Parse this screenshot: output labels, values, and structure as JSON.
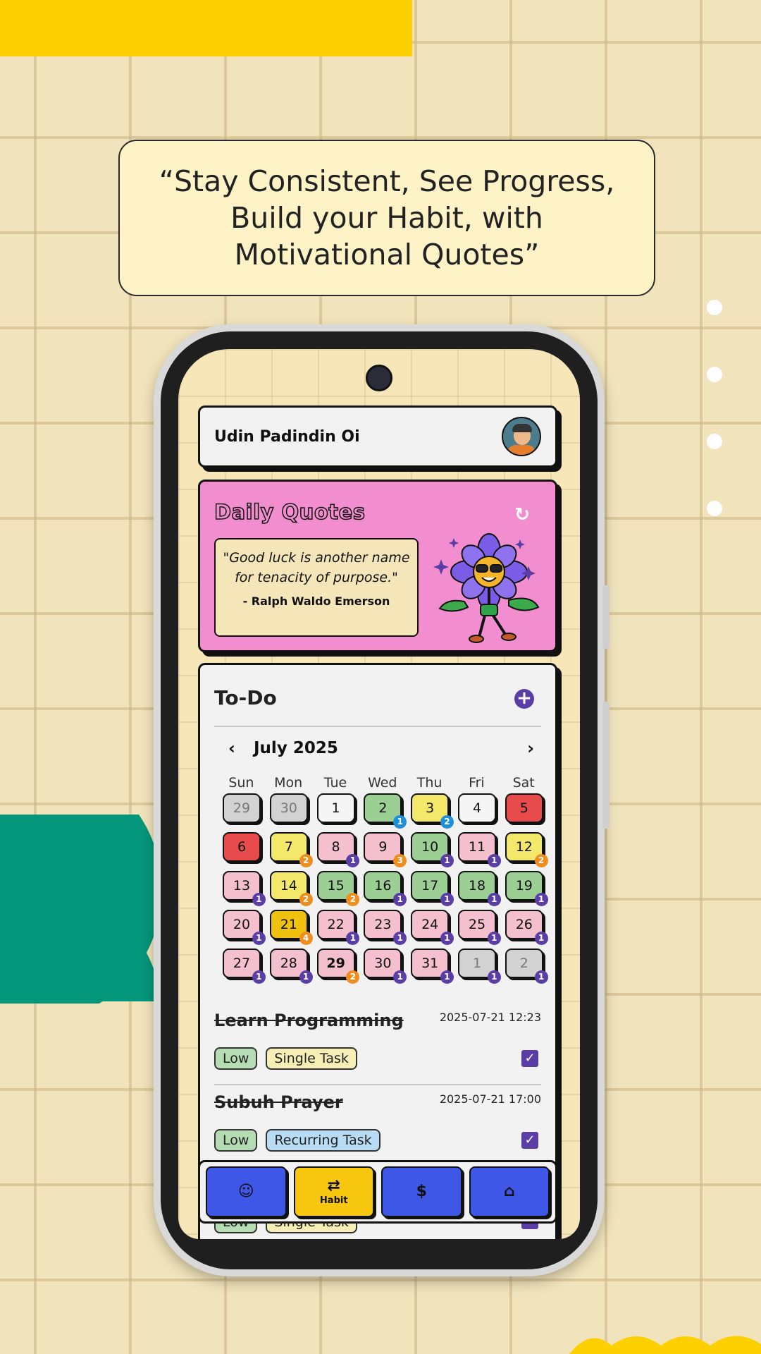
{
  "banner": {
    "quote": "“Stay Consistent, See Progress, Build your Habit, with Motivational Quotes”"
  },
  "profile": {
    "name": "Udin Padindin Oi"
  },
  "daily_quotes": {
    "title": "Daily Quotes",
    "quote": "\"Good luck is another name for tenacity of purpose.\"",
    "author": "- Ralph Waldo Emerson"
  },
  "todo": {
    "title": "To-Do",
    "month": "July 2025",
    "weekdays": [
      "Sun",
      "Mon",
      "Tue",
      "Wed",
      "Thu",
      "Fri",
      "Sat"
    ],
    "days": [
      {
        "d": "29",
        "c": "#d2d2d2",
        "muted": true
      },
      {
        "d": "30",
        "c": "#d2d2d2",
        "muted": true
      },
      {
        "d": "1",
        "c": "#f5f5f5"
      },
      {
        "d": "2",
        "c": "#9ccf94",
        "b": "1",
        "bc": "#1f8fd8"
      },
      {
        "d": "3",
        "c": "#f3e86a",
        "b": "2",
        "bc": "#1f8fd8"
      },
      {
        "d": "4",
        "c": "#f5f5f5"
      },
      {
        "d": "5",
        "c": "#e84b4b"
      },
      {
        "d": "6",
        "c": "#e84b4b"
      },
      {
        "d": "7",
        "c": "#f3e86a",
        "b": "2",
        "bc": "#ef8d1f"
      },
      {
        "d": "8",
        "c": "#f4c0cd",
        "b": "1",
        "bc": "#5a3ea5"
      },
      {
        "d": "9",
        "c": "#f4c0cd",
        "b": "3",
        "bc": "#ef8d1f"
      },
      {
        "d": "10",
        "c": "#9ccf94",
        "b": "1",
        "bc": "#5a3ea5"
      },
      {
        "d": "11",
        "c": "#f4c0cd",
        "b": "1",
        "bc": "#5a3ea5"
      },
      {
        "d": "12",
        "c": "#f3e86a",
        "b": "2",
        "bc": "#ef8d1f"
      },
      {
        "d": "13",
        "c": "#f4c0cd",
        "b": "1",
        "bc": "#5a3ea5"
      },
      {
        "d": "14",
        "c": "#f3e86a",
        "b": "2",
        "bc": "#ef8d1f"
      },
      {
        "d": "15",
        "c": "#9ccf94",
        "b": "2",
        "bc": "#ef8d1f"
      },
      {
        "d": "16",
        "c": "#9ccf94",
        "b": "1",
        "bc": "#5a3ea5"
      },
      {
        "d": "17",
        "c": "#9ccf94",
        "b": "1",
        "bc": "#5a3ea5"
      },
      {
        "d": "18",
        "c": "#9ccf94",
        "b": "1",
        "bc": "#5a3ea5"
      },
      {
        "d": "19",
        "c": "#9ccf94",
        "b": "1",
        "bc": "#5a3ea5"
      },
      {
        "d": "20",
        "c": "#f4c0cd",
        "b": "1",
        "bc": "#5a3ea5"
      },
      {
        "d": "21",
        "c": "#f0c10f",
        "b": "4",
        "bc": "#ef8d1f"
      },
      {
        "d": "22",
        "c": "#f4c0cd",
        "b": "1",
        "bc": "#5a3ea5"
      },
      {
        "d": "23",
        "c": "#f4c0cd",
        "b": "1",
        "bc": "#5a3ea5"
      },
      {
        "d": "24",
        "c": "#f4c0cd",
        "b": "1",
        "bc": "#5a3ea5"
      },
      {
        "d": "25",
        "c": "#f4c0cd",
        "b": "1",
        "bc": "#5a3ea5"
      },
      {
        "d": "26",
        "c": "#f4c0cd",
        "b": "1",
        "bc": "#5a3ea5"
      },
      {
        "d": "27",
        "c": "#f4c0cd",
        "b": "1",
        "bc": "#5a3ea5"
      },
      {
        "d": "28",
        "c": "#f4c0cd",
        "b": "1",
        "bc": "#5a3ea5"
      },
      {
        "d": "29",
        "c": "#f4c0cd",
        "b": "2",
        "bc": "#ef8d1f",
        "bold": true
      },
      {
        "d": "30",
        "c": "#f4c0cd",
        "b": "1",
        "bc": "#5a3ea5"
      },
      {
        "d": "31",
        "c": "#f4c0cd",
        "b": "1",
        "bc": "#5a3ea5"
      },
      {
        "d": "1",
        "c": "#d2d2d2",
        "b": "1",
        "bc": "#5a3ea5",
        "muted": true
      },
      {
        "d": "2",
        "c": "#d2d2d2",
        "b": "1",
        "bc": "#5a3ea5",
        "muted": true
      }
    ],
    "tasks": [
      {
        "title": "Learn Programming",
        "datetime": "2025-07-21 12:23",
        "priority": "Low",
        "type": "Single Task",
        "type_color": "#f6eeb4"
      },
      {
        "title": "Subuh Prayer",
        "datetime": "2025-07-21 17:00",
        "priority": "Low",
        "type": "Recurring Task",
        "type_color": "#b9dcf5"
      },
      {
        "title": "",
        "datetime": "",
        "priority": "Low",
        "type": "Single Task",
        "type_color": "#f6eeb4"
      }
    ]
  },
  "nav": {
    "items": [
      {
        "icon": "smiley-icon",
        "glyph": "☺",
        "label": ""
      },
      {
        "icon": "repeat-icon",
        "glyph": "⇄",
        "label": "Habit",
        "active": true
      },
      {
        "icon": "dollar-icon",
        "glyph": "$",
        "label": ""
      },
      {
        "icon": "home-icon",
        "glyph": "⌂",
        "label": ""
      }
    ]
  },
  "colors": {
    "accent_yellow": "#ffd000",
    "accent_green": "#04967a",
    "quotes_pink": "#f28ecf",
    "nav_blue": "#3f57e6",
    "purple": "#5a3ea5"
  }
}
